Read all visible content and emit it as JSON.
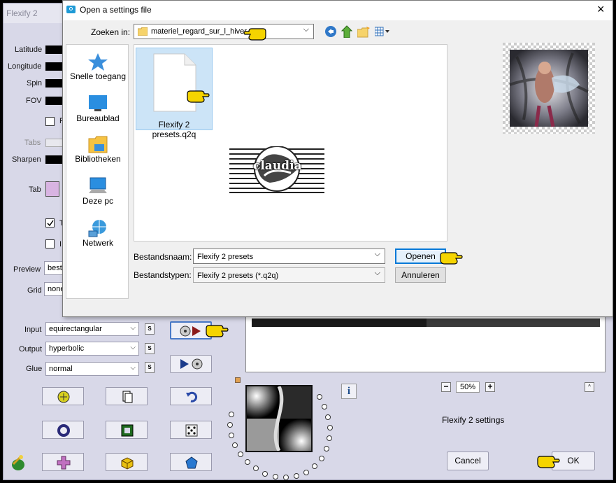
{
  "flexify": {
    "title": "Flexify 2",
    "labels": {
      "latitude": "Latitude",
      "longitude": "Longitude",
      "spin": "Spin",
      "fov": "FOV",
      "tabs": "Tabs",
      "sharpen": "Sharpen",
      "tab": "Tab",
      "preview": "Preview",
      "grid": "Grid",
      "input": "Input",
      "output": "Output",
      "glue": "Glue"
    },
    "checkbox_labels": {
      "f": "F",
      "t": "T",
      "i": "I"
    },
    "preview_value": "best",
    "grid_value": "none",
    "input_value": "equirectangular",
    "output_value": "hyperbolic",
    "glue_value": "normal",
    "s_label": "S",
    "zoom_minus": "−",
    "zoom_value": "50%",
    "zoom_plus": "+",
    "info_label": "i",
    "settings_label": "Flexify 2 settings",
    "cancel_label": "Cancel",
    "ok_label": "OK",
    "tab_color": "#d8b4e2"
  },
  "dialog": {
    "title": "Open a settings file",
    "close_label": "×",
    "look_in_label": "Zoeken in:",
    "look_in_value": "materiel_regard_sur_l_hiver",
    "places": [
      {
        "label": "Snelle toegang",
        "icon": "star-icon"
      },
      {
        "label": "Bureaublad",
        "icon": "desktop-icon"
      },
      {
        "label": "Bibliotheken",
        "icon": "libraries-icon"
      },
      {
        "label": "Deze pc",
        "icon": "computer-icon"
      },
      {
        "label": "Netwerk",
        "icon": "network-icon"
      }
    ],
    "file": {
      "name": "Flexify 2 presets.q2q"
    },
    "logo_text": "claudia",
    "filename_label": "Bestandsnaam:",
    "filename_value": "Flexify 2 presets",
    "filetype_label": "Bestandstypen:",
    "filetype_value": "Flexify 2 presets (*.q2q)",
    "open_label": "Openen",
    "cancel_label": "Annuleren"
  }
}
